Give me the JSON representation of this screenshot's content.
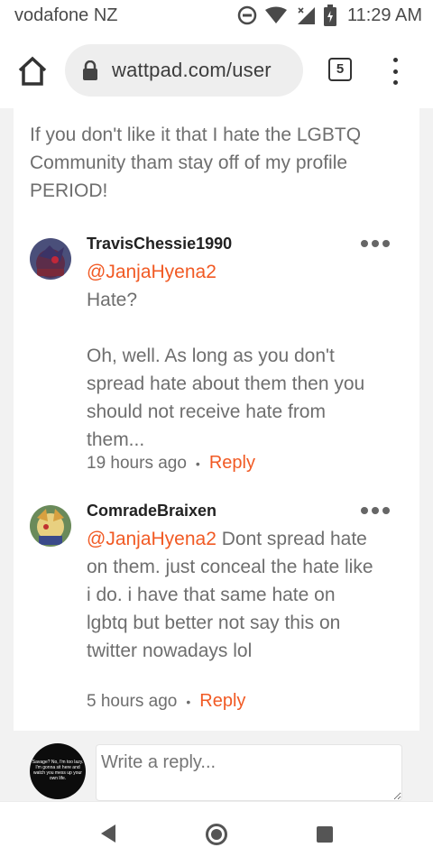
{
  "status_bar": {
    "carrier": "vodafone NZ",
    "time": "11:29 AM",
    "icons": [
      "do-not-disturb-icon",
      "wifi-icon",
      "signal-icon",
      "battery-charging-icon"
    ]
  },
  "browser": {
    "url": "wattpad.com/user",
    "tab_count": "5",
    "icons": [
      "home-icon",
      "lock-icon",
      "tabs-icon",
      "more-vert-icon"
    ]
  },
  "main_comment": {
    "text": "If you don't like it that I hate the LGBTQ Community tham stay off of my profile PERIOD!"
  },
  "replies": [
    {
      "author": "TravisChessie1990",
      "mention": "@JanjaHyena2",
      "text_line1": "Hate?",
      "text_rest": "Oh, well. As long as you don't spread hate about them then you should not receive hate from them...",
      "time": "19 hours ago",
      "reply_label": "Reply"
    },
    {
      "author": "ComradeBraixen",
      "mention": "@JanjaHyena2",
      "text_rest": " Dont spread hate on them. just conceal the hate like i do. i have that same hate on lgbtq but better not say this on twitter nowadays lol",
      "time": "5 hours ago",
      "reply_label": "Reply"
    }
  ],
  "composer": {
    "placeholder": "Write a reply...",
    "avatar_text": "Savage? No, I'm too lazy. I'm gonna sit here and watch you mess up your own life."
  },
  "nav": {
    "icons": [
      "back-icon",
      "home-circle-icon",
      "recents-icon"
    ]
  },
  "colors": {
    "accent": "#f15a24",
    "text_gray": "#6e6e6e",
    "page_bg": "#f2f2f2"
  }
}
